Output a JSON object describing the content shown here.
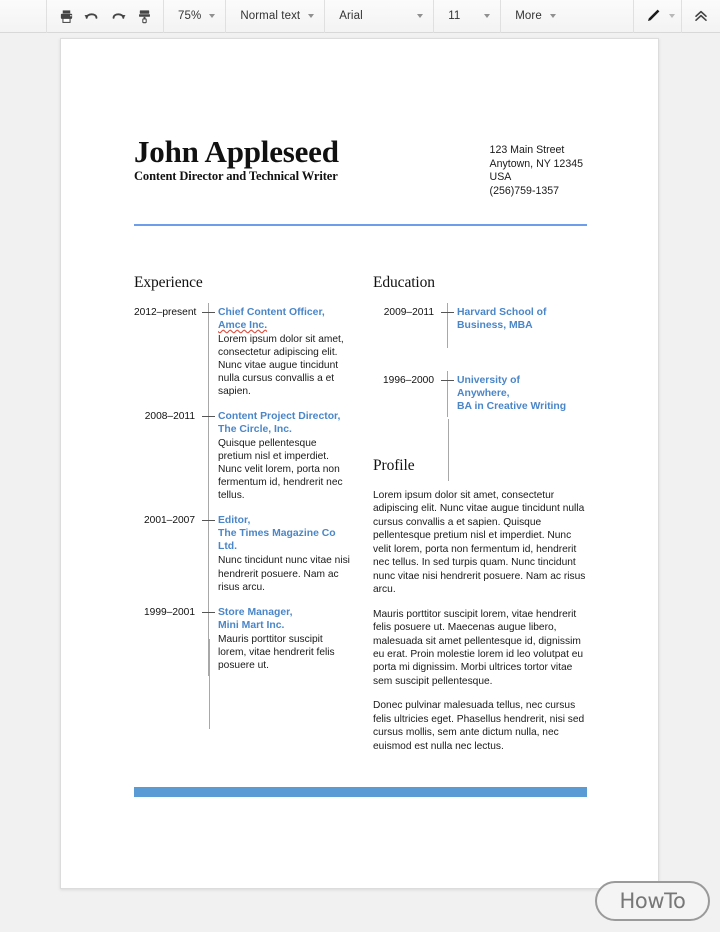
{
  "toolbar": {
    "print_icon": "print-icon",
    "undo_icon": "undo-icon",
    "redo_icon": "redo-icon",
    "paint_format_icon": "paint-format-icon",
    "zoom_value": "75%",
    "style_value": "Normal text",
    "font_value": "Arial",
    "font_size_value": "11",
    "more_label": "More",
    "edit_mode_icon": "pencil-icon",
    "collapse_icon": "chevron-double-up-icon"
  },
  "resume": {
    "name": "John Appleseed",
    "job_title": "Content Director and Technical Writer",
    "address": [
      "123 Main Street",
      "Anytown, NY 12345",
      "USA",
      "(256)759-1357"
    ],
    "experience": {
      "title": "Experience",
      "entries": [
        {
          "date": "2012–present",
          "role_line1": "Chief Content Officer,",
          "role_line2": "Amce Inc.",
          "role_line2_misspelled": true,
          "description": "Lorem ipsum dolor sit amet, consectetur adipiscing elit. Nunc vitae augue tincidunt nulla cursus convallis a et sapien."
        },
        {
          "date": "2008–2011",
          "role_line1": "Content Project Director,",
          "role_line2": "The Circle, Inc.",
          "role_line2_misspelled": false,
          "description": "Quisque pellentesque pretium nisl et imperdiet. Nunc velit lorem, porta non fermentum id, hendrerit nec tellus."
        },
        {
          "date": "2001–2007",
          "role_line1": "Editor,",
          "role_line2": "The Times Magazine Co Ltd.",
          "role_line2_misspelled": false,
          "description": "Nunc tincidunt nunc vitae nisi hendrerit posuere. Nam ac risus arcu."
        },
        {
          "date": "1999–2001",
          "role_line1": "Store Manager,",
          "role_line2": "Mini Mart Inc.",
          "role_line2_misspelled": false,
          "description": "Mauris porttitor suscipit lorem, vitae hendrerit felis posuere ut."
        }
      ]
    },
    "education": {
      "title": "Education",
      "entries": [
        {
          "date": "2009–2011",
          "role_line1": "Harvard School of",
          "role_line2": "Business, MBA",
          "role_line3": "",
          "description": ""
        },
        {
          "date": "1996–2000",
          "role_line1": "University of",
          "role_line2": "Anywhere,",
          "role_line3": "BA in Creative Writing",
          "description": ""
        }
      ]
    },
    "profile": {
      "title": "Profile",
      "paragraphs": [
        "Lorem ipsum dolor sit amet, consectetur adipiscing elit. Nunc vitae augue tincidunt nulla cursus convallis a et sapien. Quisque pellentesque pretium nisl et imperdiet. Nunc velit lorem, porta non fermentum id, hendrerit nec tellus. In sed turpis quam. Nunc tincidunt nunc vitae nisi hendrerit posuere. Nam ac risus arcu.",
        "Mauris porttitor suscipit lorem, vitae hendrerit felis posuere ut. Maecenas augue libero, malesuada sit amet pellentesque id, dignissim eu erat. Proin molestie lorem id leo volutpat eu porta mi dignissim. Morbi ultrices tortor vitae sem suscipit pellentesque.",
        "Donec pulvinar malesuada tellus, nec cursus felis ultricies eget. Phasellus hendrerit, nisi sed cursus mollis, sem ante dictum nulla, nec euismod est nulla nec lectus."
      ]
    }
  },
  "watermark": {
    "text": "HowTo"
  },
  "colors": {
    "accent_blue": "#4a86c8",
    "rule_blue": "#6d9eeb",
    "footer_blue": "#5b9bd5",
    "spell_error_red": "#e04a3c"
  }
}
